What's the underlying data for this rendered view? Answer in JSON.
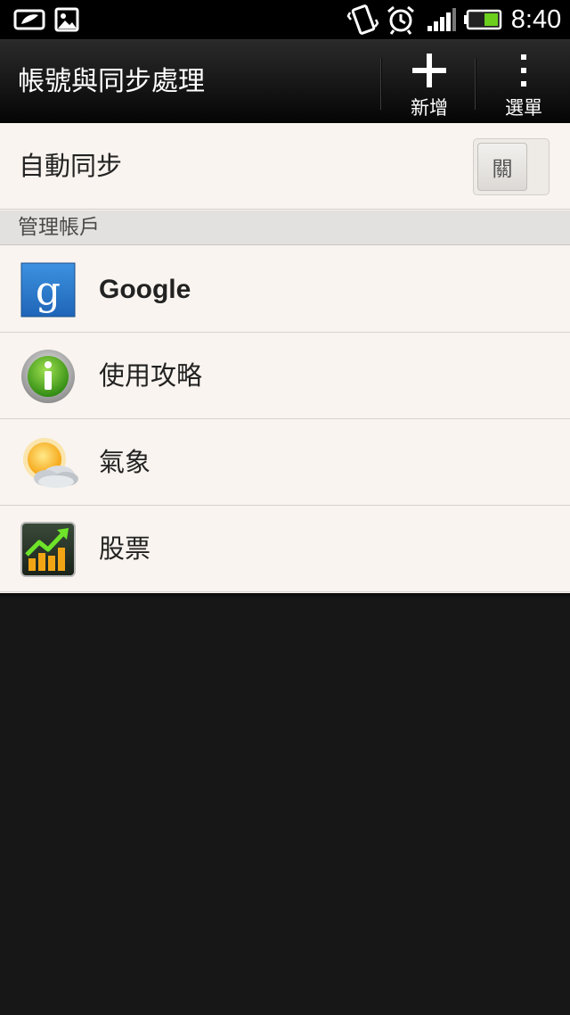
{
  "status_bar": {
    "time": "8:40",
    "icons": [
      "leaf-notification-icon",
      "image-notification-icon",
      "vibrate-icon",
      "alarm-icon",
      "signal-icon",
      "battery-icon"
    ]
  },
  "action_bar": {
    "title": "帳號與同步處理",
    "add_label": "新增",
    "menu_label": "選單"
  },
  "auto_sync": {
    "label": "自動同步",
    "toggle_state": "關"
  },
  "section": {
    "header": "管理帳戶"
  },
  "accounts": [
    {
      "name": "Google",
      "icon": "google-icon"
    },
    {
      "name": "使用攻略",
      "icon": "info-icon"
    },
    {
      "name": "氣象",
      "icon": "weather-icon"
    },
    {
      "name": "股票",
      "icon": "stocks-icon"
    }
  ],
  "colors": {
    "background": "#171717",
    "list_background": "#f9f4ef",
    "section_header": "#e3e1df",
    "google_blue": "#2f7fd0"
  }
}
